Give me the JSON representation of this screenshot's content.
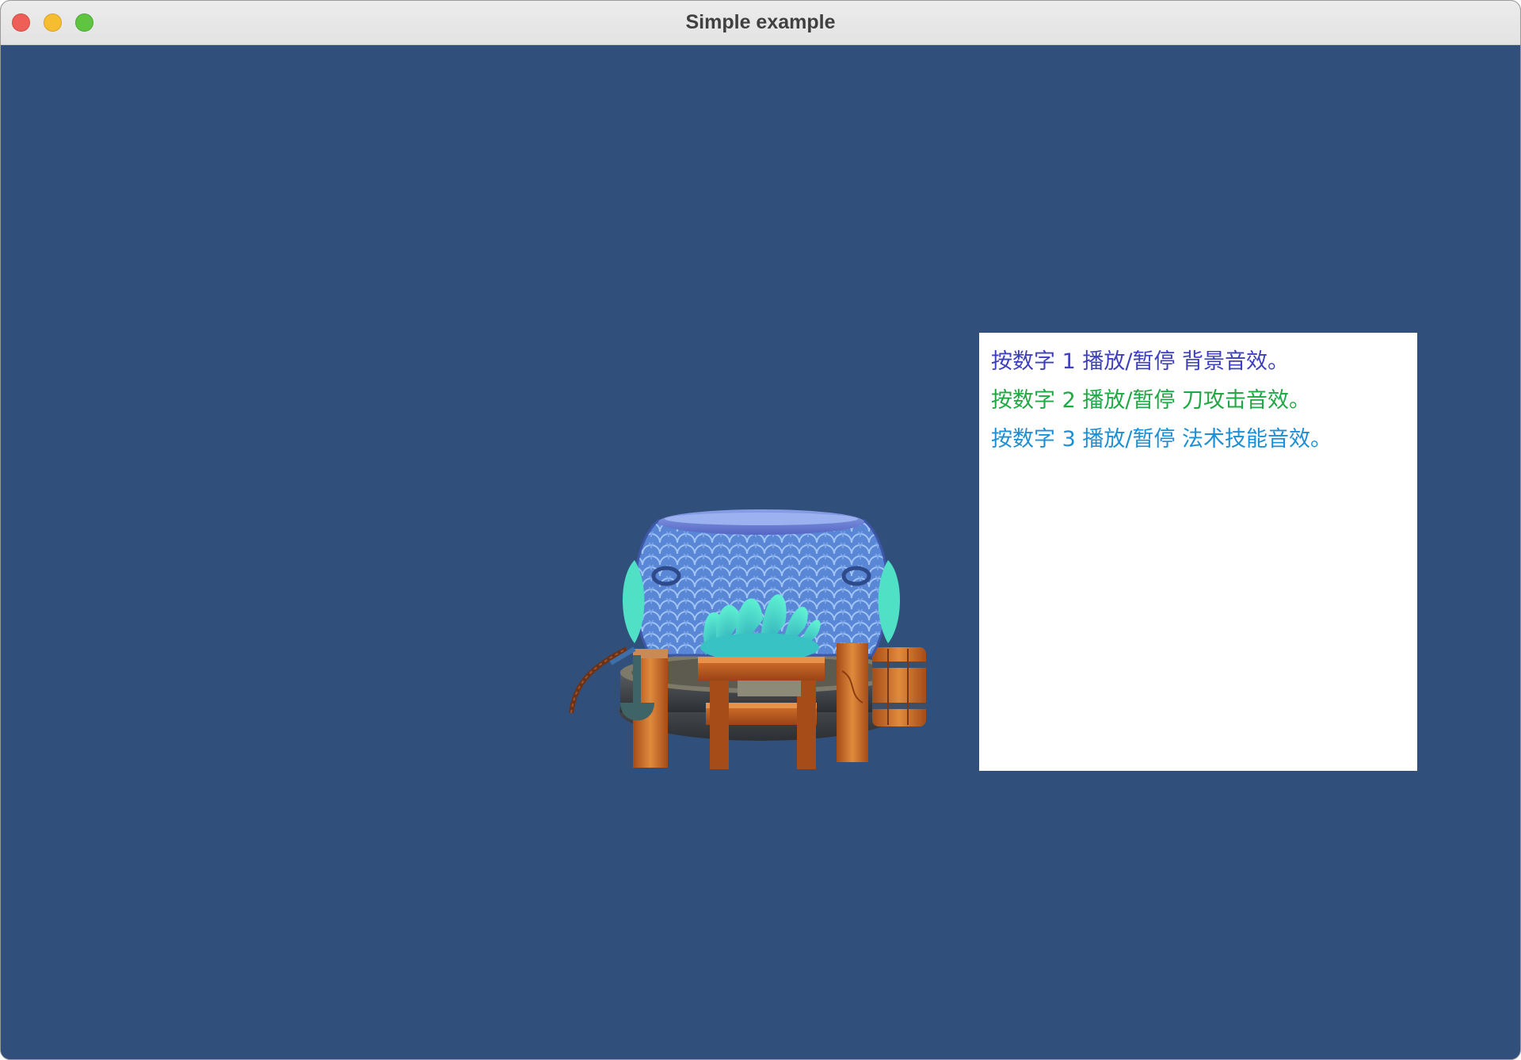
{
  "window": {
    "title": "Simple example"
  },
  "instructions": [
    {
      "text": "按数字 1 播放/暂停 背景音效。",
      "color": "#3e3fbf"
    },
    {
      "text": "按数字 2 播放/暂停 刀攻击音效。",
      "color": "#1fa844"
    },
    {
      "text": "按数字 3 播放/暂停 法术技能音效。",
      "color": "#1c8fd6"
    }
  ],
  "scene": {
    "model": "water-jar-well-model",
    "background_color": "#314f7b"
  }
}
